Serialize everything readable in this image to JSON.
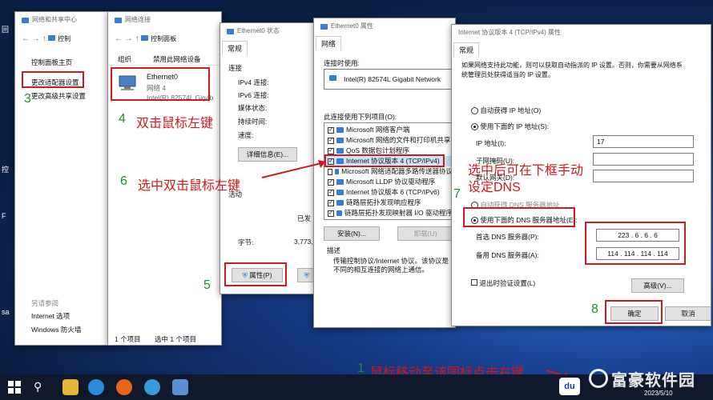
{
  "desktop": {
    "left_labels": [
      "回",
      "控",
      "F",
      "sa"
    ]
  },
  "win_network_center": {
    "title": "网络和共享中心",
    "address": "控制",
    "items": [
      "控制面板主页",
      "更改适配器设置",
      "更改高级共享设置"
    ],
    "see_also_title": "另请参阅",
    "see_also": [
      "Internet 选项",
      "Windows 防火墙"
    ]
  },
  "win_connections": {
    "title": "网络连接",
    "address": "控制面板",
    "toolbar": [
      "组织",
      "禁用此网络设备"
    ],
    "adapter": {
      "name": "Ethernet0",
      "network": "网络 4",
      "device": "Intel(R) 82574L Gigab"
    },
    "status": {
      "count": "1 个项目",
      "selected": "选中 1 个项目"
    }
  },
  "win_status": {
    "title": "Ethernet0 状态",
    "tab": "常规",
    "section_connection": "连接",
    "rows": [
      "IPv4 连接:",
      "IPv6 连接:",
      "媒体状态:",
      "持续时间:",
      "速度:"
    ],
    "details_button": "详细信息(E)...",
    "section_activity": "活动",
    "sent": "已发",
    "bytes_label": "字节:",
    "bytes_value": "3,773,",
    "properties_button": "属性(P)"
  },
  "win_properties": {
    "title": "Ethernet0 属性",
    "tab": "网络",
    "connect_using_label": "连接时使用:",
    "adapter": "Intel(R) 82574L Gigabit Network",
    "items_label": "此连接使用下列项目(O):",
    "items": [
      "Microsoft 网络客户端",
      "Microsoft 网络的文件和打印机共享",
      "QoS 数据包计划程序",
      "Internet 协议版本 4 (TCP/IPv4)",
      "Microsoft 网络适配器多路传送器协议",
      "Microsoft LLDP 协议驱动程序",
      "Internet 协议版本 6 (TCP/IPv6)",
      "链路层拓扑发现响应程序",
      "链路层拓扑发现映射器 I/O 驱动程序"
    ],
    "install_button": "安装(N)...",
    "uninstall_button": "卸载(U)",
    "description_label": "描述",
    "description": "传输控制协议/Internet 协议。该协议是\n不同的相互连接的网络上通信。"
  },
  "win_ipv4": {
    "title": "Internet 协议版本 4 (TCP/IPv4) 属性",
    "tab": "常规",
    "intro": "如果网络支持此功能，则可以获取自动指派的 IP 设置。否则，你需要从网络系\n统管理员处获得适当的 IP 设置。",
    "auto_ip": "自动获得 IP 地址(O)",
    "manual_ip": "使用下面的 IP 地址(S):",
    "ip_label": "IP 地址(I):",
    "ip_value": "17",
    "mask_label": "子网掩码(U):",
    "gateway_label": "默认网关(D):",
    "auto_dns": "自动获得 DNS 服务器地址",
    "manual_dns": "使用下面的 DNS 服务器地址(E):",
    "preferred_label": "首选 DNS 服务器(P):",
    "preferred_value": "223 .  6  .  6  .  6",
    "alternate_label": "备用 DNS 服务器(A):",
    "alternate_value": "114 . 114 . 114 . 114",
    "validate_label": "退出时验证设置(L)",
    "advanced_button": "高级(V)...",
    "ok_button": "确定",
    "cancel_button": "取消"
  },
  "annotations": {
    "n3": "3",
    "n4": "4",
    "t4": "双击鼠标左键",
    "n5": "5",
    "n6": "6",
    "t6": "选中双击鼠标左键",
    "n7": "7",
    "t7": "选中后可在下框手动\n设定DNS",
    "n8": "8",
    "n1": "1",
    "t1": "鼠标移动至该图标点击右键"
  },
  "watermark": "富豪软件园",
  "taskbar": {
    "date": "2023/5/10"
  }
}
